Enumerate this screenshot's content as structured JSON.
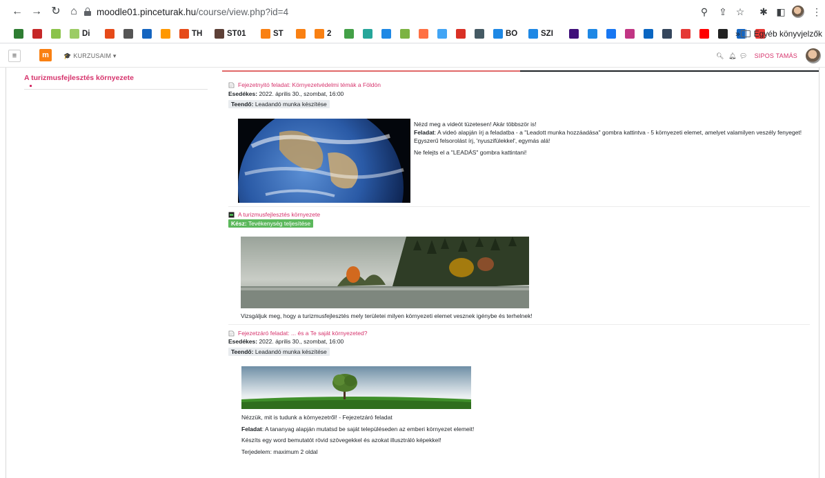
{
  "browser": {
    "url_host": "moodle01.pinceturak.hu",
    "url_path": "/course/view.php?id=4",
    "bookmarks": [
      {
        "icon": "leaf-icon",
        "label": "",
        "color": "#2e7d32"
      },
      {
        "icon": "edit-x-icon",
        "label": "",
        "color": "#c62828"
      },
      {
        "icon": "feather-icon",
        "label": "",
        "color": "#8bc34a"
      },
      {
        "icon": "di-icon",
        "label": "Di",
        "color": "#9ccc65"
      },
      {
        "icon": "cp-icon",
        "label": "",
        "color": "#e64a19"
      },
      {
        "icon": "apple-icon",
        "label": "",
        "color": "#555555"
      },
      {
        "icon": "n-icon",
        "label": "",
        "color": "#1565c0"
      },
      {
        "icon": "b-icon",
        "label": "",
        "color": "#ff9800"
      },
      {
        "icon": "cp-icon",
        "label": "TH",
        "color": "#e64a19"
      },
      {
        "icon": "st01-icon",
        "label": "ST01",
        "color": "#5d4037"
      },
      {
        "icon": "moodle-icon",
        "label": "ST",
        "color": "#f98012"
      },
      {
        "icon": "moodle-icon",
        "label": "",
        "color": "#f98012"
      },
      {
        "icon": "moodle-icon",
        "label": "2",
        "color": "#f98012"
      },
      {
        "icon": "px-icon",
        "label": "",
        "color": "#43a047"
      },
      {
        "icon": "d-icon",
        "label": "",
        "color": "#26a69a"
      },
      {
        "icon": "cloud-icon",
        "label": "",
        "color": "#1e88e5"
      },
      {
        "icon": "grid-icon",
        "label": "",
        "color": "#7cb342"
      },
      {
        "icon": "circle-icon",
        "label": "",
        "color": "#ff7043"
      },
      {
        "icon": "globe-icon",
        "label": "",
        "color": "#42a5f5"
      },
      {
        "icon": "gmail-icon",
        "label": "",
        "color": "#d93025"
      },
      {
        "icon": "mail-icon",
        "label": "",
        "color": "#455a64"
      },
      {
        "icon": "k-icon",
        "label": "BO",
        "color": "#1e88e5"
      },
      {
        "icon": "k-icon",
        "label": "SZI",
        "color": "#1e88e5"
      },
      {
        "icon": "kahoot-icon",
        "label": "",
        "color": "#3f0f7a"
      },
      {
        "icon": "translate-icon",
        "label": "",
        "color": "#1e88e5"
      },
      {
        "icon": "facebook-icon",
        "label": "",
        "color": "#1877f2"
      },
      {
        "icon": "instagram-icon",
        "label": "",
        "color": "#c13584"
      },
      {
        "icon": "linkedin-icon",
        "label": "",
        "color": "#0a66c2"
      },
      {
        "icon": "tumblr-icon",
        "label": "",
        "color": "#35465c"
      },
      {
        "icon": "circle-red-icon",
        "label": "",
        "color": "#e53935"
      },
      {
        "icon": "youtube-icon",
        "label": "",
        "color": "#ff0000"
      },
      {
        "icon": "wave-icon",
        "label": "",
        "color": "#222222"
      },
      {
        "icon": "n-icon",
        "label": "",
        "color": "#1565c0"
      },
      {
        "icon": "hvg-icon",
        "label": "",
        "color": "#e53935"
      }
    ],
    "other_bookmarks": "Egyéb könyvjelzők",
    "overflow": "»"
  },
  "moodle": {
    "menu_label": "KURZUSAIM",
    "user_name": "SIPOS TAMÁS",
    "logo": "m"
  },
  "drawer": {
    "title": "A turizmusfejlesztés környezete"
  },
  "activities": {
    "a1": {
      "title": "Fejezetnyitó feladat: Környezetvédelmi témák a Földön",
      "due_label": "Esedékes:",
      "due_value": "2022. április 30., szombat, 16:00",
      "todo_label": "Teendő:",
      "todo_value": "Leadandó munka készítése",
      "line1": "Nézd meg a videót tüzetesen! Akár többször is!",
      "task_label": "Feladat",
      "task_text": ": A videó alapján írj a feladatba - a \"Leadott munka hozzáadása\" gombra kattintva - 5 környezeti elemet, amelyet valamilyen veszély fenyeget!",
      "line3": "Egyszerű felsorolást írj, 'nyuszifülekkel', egymás alá!",
      "line4": "Ne felejts el a \"LEADÁS\" gombra kattintani!"
    },
    "a2": {
      "title": "A turizmusfejlesztés környezete",
      "done_label": "Kész:",
      "done_value": "Tevékenység teljesítése",
      "caption": "Vizsgáljuk meg, hogy a turizmusfejlesztés mely területei milyen környezeti elemet vesznek igénybe és terhelnek!"
    },
    "a3": {
      "title": "Fejezetzáró feladat: ... és a Te saját környezeted?",
      "due_label": "Esedékes:",
      "due_value": "2022. április 30., szombat, 16:00",
      "todo_label": "Teendő:",
      "todo_value": "Leadandó munka készítése",
      "line1": "Nézzük, mit is tudunk a környezetről! - Fejezetzáró feladat",
      "task_label": "Feladat",
      "task_text": ": A tananyag alapján mutatsd be saját településeden az emberi környezet elemeit!",
      "line3": "Készíts egy word bemutatót rövid szövegekkel és azokat illusztráló képekkel!",
      "line4": "Terjedelem: maximum 2 oldal"
    }
  }
}
